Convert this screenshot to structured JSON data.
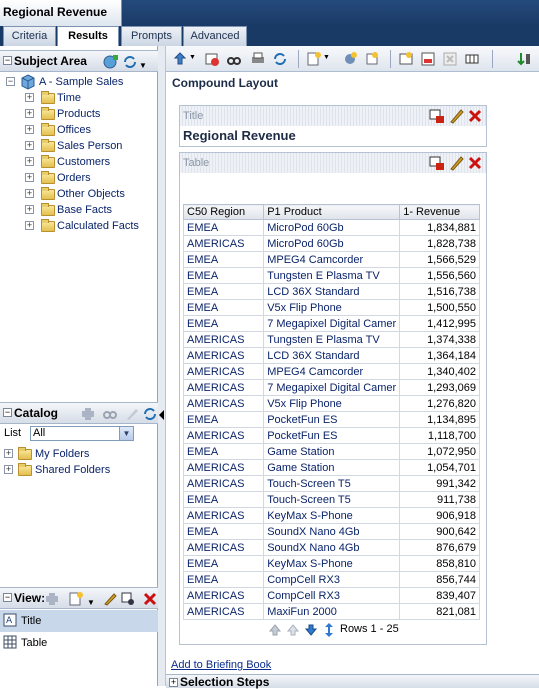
{
  "window": {
    "title": "Regional Revenue"
  },
  "tabs": [
    {
      "label": "Criteria"
    },
    {
      "label": "Results"
    },
    {
      "label": "Prompts"
    },
    {
      "label": "Advanced"
    }
  ],
  "subject_area": {
    "header": "Subject Area",
    "root": "A - Sample Sales",
    "folders": [
      "Time",
      "Products",
      "Offices",
      "Sales Person",
      "Customers",
      "Orders",
      "Other Objects",
      "Base Facts",
      "Calculated Facts"
    ]
  },
  "catalog": {
    "header": "Catalog",
    "list_label": "List",
    "list_value": "All",
    "folders": [
      "My Folders",
      "Shared Folders"
    ]
  },
  "views": {
    "header": "View:",
    "items": [
      "Title",
      "Table"
    ]
  },
  "layout": {
    "heading": "Compound Layout",
    "title_view": {
      "header": "Title",
      "text": "Regional Revenue"
    },
    "table_view": {
      "header": "Table",
      "columns": [
        "C50 Region",
        "P1 Product",
        "1- Revenue"
      ],
      "rows": [
        [
          "EMEA",
          "MicroPod 60Gb",
          "1,834,881"
        ],
        [
          "AMERICAS",
          "MicroPod 60Gb",
          "1,828,738"
        ],
        [
          "EMEA",
          "MPEG4 Camcorder",
          "1,566,529"
        ],
        [
          "EMEA",
          "Tungsten E Plasma TV",
          "1,556,560"
        ],
        [
          "EMEA",
          "LCD 36X Standard",
          "1,516,738"
        ],
        [
          "EMEA",
          "V5x Flip Phone",
          "1,500,550"
        ],
        [
          "EMEA",
          "7 Megapixel Digital Camer",
          "1,412,995"
        ],
        [
          "AMERICAS",
          "Tungsten E Plasma TV",
          "1,374,338"
        ],
        [
          "AMERICAS",
          "LCD 36X Standard",
          "1,364,184"
        ],
        [
          "AMERICAS",
          "MPEG4 Camcorder",
          "1,340,402"
        ],
        [
          "AMERICAS",
          "7 Megapixel Digital Camer",
          "1,293,069"
        ],
        [
          "AMERICAS",
          "V5x Flip Phone",
          "1,276,820"
        ],
        [
          "EMEA",
          "PocketFun ES",
          "1,134,895"
        ],
        [
          "AMERICAS",
          "PocketFun ES",
          "1,118,700"
        ],
        [
          "EMEA",
          "Game Station",
          "1,072,950"
        ],
        [
          "AMERICAS",
          "Game Station",
          "1,054,701"
        ],
        [
          "AMERICAS",
          "Touch-Screen T5",
          "991,342"
        ],
        [
          "EMEA",
          "Touch-Screen T5",
          "911,738"
        ],
        [
          "AMERICAS",
          "KeyMax S-Phone",
          "906,918"
        ],
        [
          "EMEA",
          "SoundX Nano 4Gb",
          "900,642"
        ],
        [
          "AMERICAS",
          "SoundX Nano 4Gb",
          "876,679"
        ],
        [
          "EMEA",
          "KeyMax S-Phone",
          "858,810"
        ],
        [
          "EMEA",
          "CompCell RX3",
          "856,744"
        ],
        [
          "AMERICAS",
          "CompCell RX3",
          "839,407"
        ],
        [
          "AMERICAS",
          "MaxiFun 2000",
          "821,081"
        ]
      ],
      "pager_text": "Rows 1 - 25"
    },
    "briefing_link": "Add to Briefing Book",
    "selection_steps": "Selection Steps"
  },
  "colors": {
    "accent": "#1a3a66",
    "link": "#0a246a",
    "delete": "#cc1111"
  }
}
